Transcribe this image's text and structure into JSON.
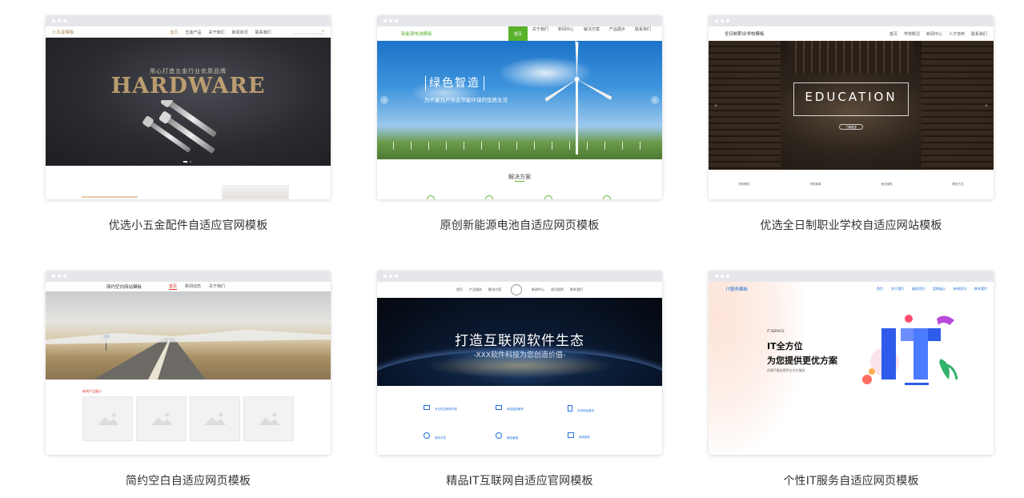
{
  "templates": [
    {
      "caption": "优选小五金配件自适应官网模板",
      "site_logo": "小五金模板",
      "nav": [
        "首页",
        "五金产品",
        "关于我们",
        "新闻资讯",
        "联系我们"
      ],
      "hero_subtitle": "用心打造五金行业优质品牌",
      "hero_title": "HARDWARE"
    },
    {
      "caption": "原创新能源电池自适应网页模板",
      "site_logo": "新能源电池模板",
      "nav": [
        "首页",
        "关于我们",
        "新闻中心",
        "解决方案",
        "产品展示",
        "联系我们"
      ],
      "hero_title": "绿色智造",
      "hero_subtitle": "为千家万户节去节能环保的优质生活",
      "section_title": "解决方案"
    },
    {
      "caption": "优选全日制职业学校自适应网站模板",
      "site_logo": "全日制职业学校模板",
      "nav": [
        "首页",
        "学校概况",
        "新闻中心",
        "人才培养",
        "联系我们"
      ],
      "hero_title": "EDUCATION",
      "hero_button": "了解更多",
      "stats": [
        "学校概况",
        "学校新闻",
        "就业指导",
        "联系方式"
      ]
    },
    {
      "caption": "简约空白自适应网页模板",
      "site_logo": "简约空白网站模板",
      "nav": [
        "首页",
        "新闻动态",
        "关于我们"
      ],
      "section_title": "新闻产品展示"
    },
    {
      "caption": "精品IT互联网自适应官网模板",
      "nav": [
        "首页",
        "产品服务",
        "解决方案",
        "新闻中心",
        "成功案例",
        "联系我们"
      ],
      "hero_title": "打造互联网软件生态",
      "hero_subtitle": "-XXX软件科技为您创造价值-",
      "features": [
        "专业的互联网开发",
        "网站建设服务",
        "手机网站建设",
        "软件开发",
        "微信营销",
        "电商服务"
      ]
    },
    {
      "caption": "个性IT服务自适应网页模板",
      "site_logo": "IT服务模板",
      "nav": [
        "首页",
        "关于我们",
        "服务项目",
        "案例展示",
        "新闻资讯",
        "联系我们"
      ],
      "hero_kicker": "IT SERVICE",
      "hero_title_1": "IT全方位",
      "hero_title_2": "为您提供更优方案",
      "hero_desc": "优服IT服务提供全方位服务",
      "illustration_text": "IT"
    }
  ],
  "colors": {
    "green_accent": "#59b22c",
    "blue_accent": "#1e6fd9",
    "red_accent": "#d9342b",
    "gold": "#b08d57"
  }
}
